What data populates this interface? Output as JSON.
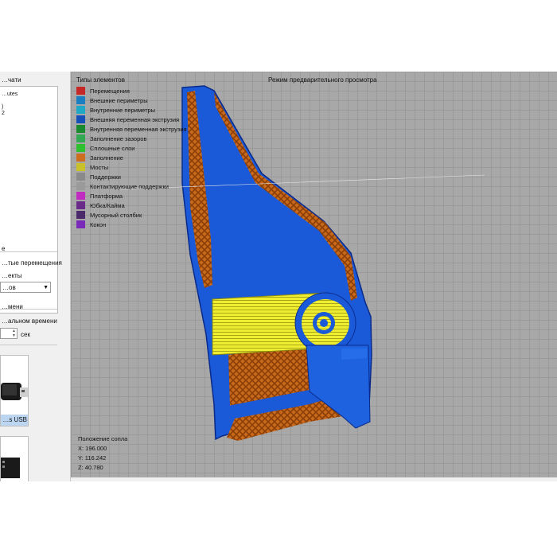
{
  "left_panel": {
    "print_section_title": "…чати",
    "tree_items": [
      "…utes",
      ")",
      "2"
    ],
    "travel_section_title": "e",
    "travel_checkbox_label": "…тые перемещения",
    "objects_label": "…екты",
    "objects_select_value": "…ов",
    "time_section_title": "…мени",
    "realtime_label": "…альном времени",
    "seconds_unit": "сек",
    "devices": [
      {
        "label": "…s USB",
        "icon": "usb-drive-icon"
      },
      {
        "label": "",
        "icon": "sd-card-icon"
      }
    ]
  },
  "viewport": {
    "mode_title": "Режим предварительного просмотра",
    "legend_title": "Типы элементов",
    "legend": [
      {
        "label": "Перемещения",
        "color": "#c62828"
      },
      {
        "label": "Внешние периметры",
        "color": "#1a7fc1"
      },
      {
        "label": "Внутренние периметры",
        "color": "#1fa8c6"
      },
      {
        "label": "Внешняя переменная экструзия",
        "color": "#1450b8"
      },
      {
        "label": "Внутренняя переменная экструзия",
        "color": "#1a8a2f"
      },
      {
        "label": "Заполнение зазоров",
        "color": "#32a852"
      },
      {
        "label": "Сплошные слои",
        "color": "#2ec02e"
      },
      {
        "label": "Заполнение",
        "color": "#cc6e1e"
      },
      {
        "label": "Мосты",
        "color": "#c9c02a"
      },
      {
        "label": "Поддержки",
        "color": "#8a8a8a"
      },
      {
        "label": "Контактирующие поддержки",
        "color": "#9a9a9a"
      },
      {
        "label": "Платформа",
        "color": "#c02bc0"
      },
      {
        "label": "Юбка/Кайма",
        "color": "#6a2a8a"
      },
      {
        "label": "Мусорный столбик",
        "color": "#4a2a6a"
      },
      {
        "label": "Кокон",
        "color": "#7a2ab8"
      }
    ],
    "nozzle": {
      "title": "Положение сопла",
      "x": "X: 196.000",
      "y": "Y: 116.242",
      "z": "Z: 40.780"
    },
    "colors": {
      "model_blue": "#1a5ad8",
      "infill_orange": "#c8681a",
      "bridge_yellow": "#e8e82a"
    }
  }
}
